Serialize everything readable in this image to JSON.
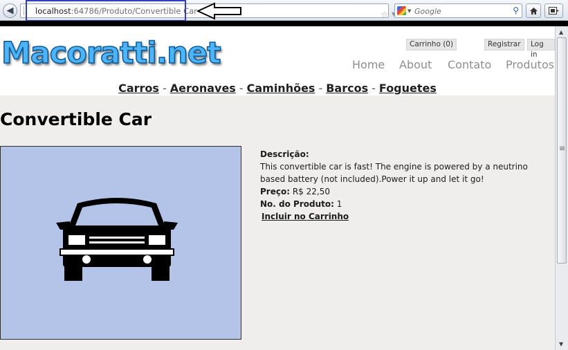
{
  "browser": {
    "url_host": "localhost",
    "url_path": ":64786/Produto/Convertible Car",
    "search_placeholder": "Google"
  },
  "site": {
    "logo_text": "Macoratti.net",
    "cart_label": "Carrinho (0)",
    "register_label": "Registrar",
    "login_label": "Log in",
    "menu": [
      "Home",
      "About",
      "Contato",
      "Produtos"
    ],
    "categories": [
      "Carros",
      "Aeronaves",
      "Caminhões",
      "Barcos",
      "Foguetes"
    ],
    "category_separator": "-"
  },
  "product": {
    "title": "Convertible Car",
    "description_label": "Descrição:",
    "description": "This convertible car is fast! The engine is powered by a neutrino based battery (not included).Power it up and let it go!",
    "price_label": "Preço:",
    "price": "R$ 22,50",
    "number_label": "No. do Produto:",
    "number": "1",
    "add_to_cart": "Incluir no Carrinho"
  },
  "colors": {
    "logo_fill": "#4fb4f6",
    "image_background": "#b4c4e8",
    "url_highlight": "#2f3fc0"
  }
}
